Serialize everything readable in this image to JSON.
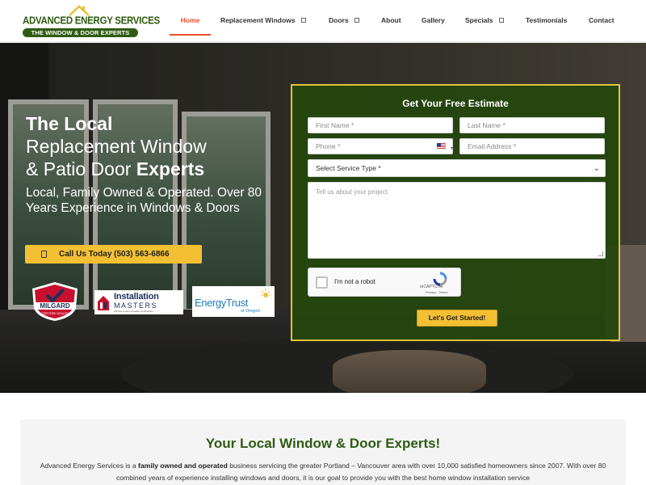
{
  "brand": {
    "name": "ADVANCED ENERGY SERVICES",
    "tagline": "THE WINDOW & DOOR EXPERTS",
    "color": "#2f5b12"
  },
  "nav": {
    "items": [
      {
        "label": "Home",
        "active": true
      },
      {
        "label": "Replacement Windows",
        "has_dropdown": true
      },
      {
        "label": "Doors",
        "has_dropdown": true
      },
      {
        "label": "About"
      },
      {
        "label": "Gallery"
      },
      {
        "label": "Specials",
        "has_dropdown": true
      },
      {
        "label": "Testimonials"
      },
      {
        "label": "Contact"
      }
    ],
    "active_color": "#e9502a"
  },
  "hero": {
    "title_line1": "The Local",
    "title_line2": "Replacement Window",
    "title_line3a": "& Patio Door ",
    "title_line3b": "Experts",
    "subtitle": "Local, Family Owned & Operated. Over 80 Years Experience in Windows & Doors",
    "cta_label": "Call Us Today (503) 563-6866",
    "cta_color": "#f3c034",
    "badges": {
      "milgard_name": "MILGARD",
      "milgard_sub": "CERTIFIED DEALER",
      "installation_line1": "Installation",
      "installation_line2": "MASTERS",
      "installation_line3": "Window & Door Installer Certification",
      "energy_trust_name": "EnergyTrust",
      "energy_trust_sub": "of Oregon"
    }
  },
  "form": {
    "title": "Get Your Free Estimate",
    "first_name_placeholder": "First Name *",
    "last_name_placeholder": "Last Name *",
    "phone_placeholder": "Phone *",
    "email_placeholder": "Email Address *",
    "service_select": "Select Service Type *",
    "project_placeholder": "Tell us about your project.",
    "captcha_label": "I'm not a robot",
    "captcha_brand": "reCAPTCHA",
    "captcha_terms": "Privacy - Terms",
    "submit_label": "Let's Get Started!",
    "panel_color": "#25470e",
    "border_color": "#e3c23a"
  },
  "about": {
    "title": "Your Local Window & Door Experts!",
    "p_before": "Advanced Energy Services is a ",
    "p_bold": "family owned and operated",
    "p_after": " business servicing the greater Portland – Vancouver area with over 10,000 satisfied homeowners since 2007. With over 80 combined years of experience installing windows and doors, it is our goal to provide you with the best home window installation service"
  }
}
